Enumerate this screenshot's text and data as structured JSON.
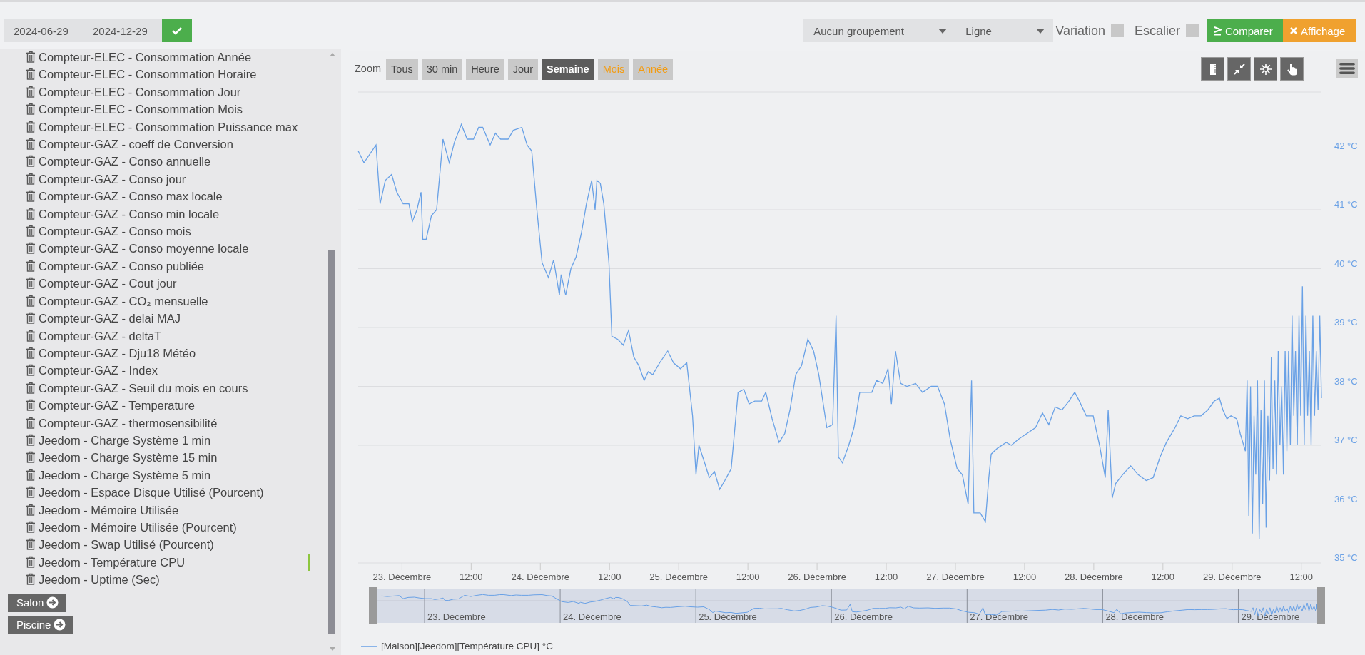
{
  "toolbar": {
    "start_date": "2024-06-29",
    "end_date": "2024-12-29",
    "grouping": "Aucun groupement",
    "chart_type": "Ligne",
    "options": [
      {
        "label": "Variation",
        "checked": false
      },
      {
        "label": "Escalier",
        "checked": false
      }
    ],
    "buttons": [
      {
        "kind": "compare",
        "label": "Comparer"
      },
      {
        "kind": "display",
        "label": "Affichage"
      }
    ]
  },
  "sidebar": {
    "items": [
      {
        "label": "Compteur-ELEC - Consommation Année",
        "selected": false
      },
      {
        "label": "Compteur-ELEC - Consommation Horaire",
        "selected": false
      },
      {
        "label": "Compteur-ELEC - Consommation Jour",
        "selected": false
      },
      {
        "label": "Compteur-ELEC - Consommation Mois",
        "selected": false
      },
      {
        "label": "Compteur-ELEC - Consommation Puissance max",
        "selected": false
      },
      {
        "label": "Compteur-GAZ - coeff de Conversion",
        "selected": false
      },
      {
        "label": "Compteur-GAZ - Conso annuelle",
        "selected": false
      },
      {
        "label": "Compteur-GAZ - Conso jour",
        "selected": false
      },
      {
        "label": "Compteur-GAZ - Conso max locale",
        "selected": false
      },
      {
        "label": "Compteur-GAZ - Conso min locale",
        "selected": false
      },
      {
        "label": "Compteur-GAZ - Conso mois",
        "selected": false
      },
      {
        "label": "Compteur-GAZ - Conso moyenne locale",
        "selected": false
      },
      {
        "label": "Compteur-GAZ - Conso publiée",
        "selected": false
      },
      {
        "label": "Compteur-GAZ - Cout jour",
        "selected": false
      },
      {
        "label": "Compteur-GAZ - CO₂ mensuelle",
        "selected": false
      },
      {
        "label": "Compteur-GAZ - delai MAJ",
        "selected": false
      },
      {
        "label": "Compteur-GAZ - deltaT",
        "selected": false
      },
      {
        "label": "Compteur-GAZ - Dju18 Météo",
        "selected": false
      },
      {
        "label": "Compteur-GAZ - Index",
        "selected": false
      },
      {
        "label": "Compteur-GAZ - Seuil du mois en cours",
        "selected": false
      },
      {
        "label": "Compteur-GAZ - Temperature",
        "selected": false
      },
      {
        "label": "Compteur-GAZ - thermosensibilité",
        "selected": false
      },
      {
        "label": "Jeedom - Charge Système 1 min",
        "selected": false
      },
      {
        "label": "Jeedom - Charge Système 15 min",
        "selected": false
      },
      {
        "label": "Jeedom - Charge Système 5 min",
        "selected": false
      },
      {
        "label": "Jeedom - Espace Disque Utilisé (Pourcent)",
        "selected": false
      },
      {
        "label": "Jeedom - Mémoire Utilisée",
        "selected": false
      },
      {
        "label": "Jeedom - Mémoire Utilisée (Pourcent)",
        "selected": false
      },
      {
        "label": "Jeedom - Swap Utilisé (Pourcent)",
        "selected": false
      },
      {
        "label": "Jeedom - Température CPU",
        "selected": true
      },
      {
        "label": "Jeedom - Uptime (Sec)",
        "selected": false
      }
    ],
    "rooms": [
      "Salon",
      "Piscine"
    ]
  },
  "chart_panel": {
    "zoom_label": "Zoom",
    "zoom_buttons": [
      {
        "label": "Tous",
        "selected": false,
        "disabled": false
      },
      {
        "label": "30 min",
        "selected": false,
        "disabled": false
      },
      {
        "label": "Heure",
        "selected": false,
        "disabled": false
      },
      {
        "label": "Jour",
        "selected": false,
        "disabled": false
      },
      {
        "label": "Semaine",
        "selected": true,
        "disabled": false
      },
      {
        "label": "Mois",
        "selected": false,
        "disabled": true
      },
      {
        "label": "Année",
        "selected": false,
        "disabled": true
      }
    ],
    "chart_data": {
      "type": "line",
      "grid": true,
      "x": [
        "2024-12-22 16:24",
        "2024-12-22 17:24",
        "2024-12-22 19:30",
        "2024-12-22 20:12",
        "2024-12-22 21:06",
        "2024-12-22 22:12",
        "2024-12-22 23:06",
        "2024-12-23 00:12",
        "2024-12-23 01:12",
        "2024-12-23 01:48",
        "2024-12-23 02:36",
        "2024-12-23 03:18",
        "2024-12-23 03:36",
        "2024-12-23 04:12",
        "2024-12-23 05:06",
        "2024-12-23 06:00",
        "2024-12-23 07:06",
        "2024-12-23 08:12",
        "2024-12-23 09:06",
        "2024-12-23 10:18",
        "2024-12-23 11:18",
        "2024-12-23 12:24",
        "2024-12-23 13:18",
        "2024-12-23 14:00",
        "2024-12-23 15:18",
        "2024-12-23 16:12",
        "2024-12-23 17:06",
        "2024-12-23 18:24",
        "2024-12-23 19:18",
        "2024-12-23 20:48",
        "2024-12-23 21:42",
        "2024-12-23 22:30",
        "2024-12-23 23:24",
        "2024-12-24 00:18",
        "2024-12-24 01:24",
        "2024-12-24 02:18",
        "2024-12-24 03:18",
        "2024-12-24 03:36",
        "2024-12-24 04:24",
        "2024-12-24 05:18",
        "2024-12-24 06:12",
        "2024-12-24 07:06",
        "2024-12-24 08:00",
        "2024-12-24 08:54",
        "2024-12-24 09:30",
        "2024-12-24 09:48",
        "2024-12-24 10:24",
        "2024-12-24 11:00",
        "2024-12-24 11:54",
        "2024-12-24 12:24",
        "2024-12-24 13:24",
        "2024-12-24 14:24",
        "2024-12-24 15:18",
        "2024-12-24 16:12",
        "2024-12-24 17:06",
        "2024-12-24 18:00",
        "2024-12-24 18:42",
        "2024-12-24 19:30",
        "2024-12-24 20:42",
        "2024-12-24 22:06",
        "2024-12-24 23:06",
        "2024-12-25 00:18",
        "2024-12-25 01:24",
        "2024-12-25 02:24",
        "2024-12-25 03:00",
        "2024-12-25 03:30",
        "2024-12-25 04:30",
        "2024-12-25 05:18",
        "2024-12-25 06:12",
        "2024-12-25 07:06",
        "2024-12-25 08:00",
        "2024-12-25 09:06",
        "2024-12-25 10:18",
        "2024-12-25 11:18",
        "2024-12-25 12:12",
        "2024-12-25 13:12",
        "2024-12-25 14:24",
        "2024-12-25 15:06",
        "2024-12-25 16:12",
        "2024-12-25 17:24",
        "2024-12-25 18:24",
        "2024-12-25 19:18",
        "2024-12-25 20:18",
        "2024-12-25 21:18",
        "2024-12-25 22:24",
        "2024-12-25 23:24",
        "2024-12-26 00:18",
        "2024-12-26 01:42",
        "2024-12-26 02:42",
        "2024-12-26 03:18",
        "2024-12-26 03:42",
        "2024-12-26 04:24",
        "2024-12-26 05:30",
        "2024-12-26 06:24",
        "2024-12-26 07:24",
        "2024-12-26 08:30",
        "2024-12-26 09:30",
        "2024-12-26 10:18",
        "2024-12-26 11:24",
        "2024-12-26 12:18",
        "2024-12-26 12:54",
        "2024-12-26 13:36",
        "2024-12-26 14:30",
        "2024-12-26 15:36",
        "2024-12-26 17:06",
        "2024-12-26 18:18",
        "2024-12-26 19:48",
        "2024-12-26 20:54",
        "2024-12-26 22:06",
        "2024-12-26 23:06",
        "2024-12-27 00:18",
        "2024-12-27 01:12",
        "2024-12-27 02:12",
        "2024-12-27 02:48",
        "2024-12-27 03:12",
        "2024-12-27 04:18",
        "2024-12-27 05:12",
        "2024-12-27 05:48",
        "2024-12-27 06:12",
        "2024-12-27 07:18",
        "2024-12-27 08:48",
        "2024-12-27 09:42",
        "2024-12-27 10:54",
        "2024-12-27 12:24",
        "2024-12-27 13:54",
        "2024-12-27 15:06",
        "2024-12-27 16:12",
        "2024-12-27 17:18",
        "2024-12-27 18:30",
        "2024-12-27 19:42",
        "2024-12-27 20:42",
        "2024-12-27 21:30",
        "2024-12-27 22:42",
        "2024-12-27 23:54",
        "2024-12-28 01:00",
        "2024-12-28 02:00",
        "2024-12-28 02:30",
        "2024-12-28 03:12",
        "2024-12-28 03:48",
        "2024-12-28 05:00",
        "2024-12-28 06:24",
        "2024-12-28 07:42",
        "2024-12-28 09:06",
        "2024-12-28 10:18",
        "2024-12-28 11:30",
        "2024-12-28 12:36",
        "2024-12-28 14:06",
        "2024-12-28 15:06",
        "2024-12-28 16:18",
        "2024-12-28 17:24",
        "2024-12-28 18:36",
        "2024-12-28 19:48",
        "2024-12-28 20:54",
        "2024-12-28 21:48",
        "2024-12-28 22:24",
        "2024-12-28 23:06",
        "2024-12-28 23:48",
        "2024-12-29 00:48",
        "2024-12-29 01:24",
        "2024-12-29 02:18",
        "2024-12-29 02:36",
        "2024-12-29 02:54",
        "2024-12-29 03:12",
        "2024-12-29 03:30",
        "2024-12-29 03:48",
        "2024-12-29 04:06",
        "2024-12-29 04:24",
        "2024-12-29 04:42",
        "2024-12-29 05:00",
        "2024-12-29 05:18",
        "2024-12-29 05:36",
        "2024-12-29 05:54",
        "2024-12-29 06:12",
        "2024-12-29 06:30",
        "2024-12-29 06:48",
        "2024-12-29 07:06",
        "2024-12-29 07:24",
        "2024-12-29 07:42",
        "2024-12-29 08:00",
        "2024-12-29 08:18",
        "2024-12-29 08:36",
        "2024-12-29 08:54",
        "2024-12-29 09:12",
        "2024-12-29 09:30",
        "2024-12-29 09:48",
        "2024-12-29 10:06",
        "2024-12-29 10:24",
        "2024-12-29 10:42",
        "2024-12-29 11:00",
        "2024-12-29 11:18",
        "2024-12-29 11:36",
        "2024-12-29 11:54",
        "2024-12-29 12:12",
        "2024-12-29 12:30",
        "2024-12-29 12:48",
        "2024-12-29 13:06",
        "2024-12-29 13:24",
        "2024-12-29 13:42",
        "2024-12-29 14:00",
        "2024-12-29 14:18",
        "2024-12-29 14:36",
        "2024-12-29 14:54",
        "2024-12-29 15:12",
        "2024-12-29 15:30"
      ],
      "series": [
        {
          "name": "[Maison][Jeedom][Température CPU] °C",
          "color": "#69a1e6",
          "values": [
            42.0,
            41.8,
            42.1,
            41.1,
            41.5,
            41.6,
            41.3,
            41.1,
            41.1,
            40.8,
            41.0,
            41.3,
            40.5,
            40.5,
            40.9,
            41.0,
            42.2,
            41.8,
            42.15,
            42.45,
            42.2,
            42.2,
            42.4,
            42.4,
            42.1,
            42.3,
            42.2,
            42.2,
            42.35,
            42.4,
            42.1,
            42.0,
            41.0,
            40.1,
            39.85,
            40.15,
            39.55,
            39.9,
            39.55,
            40.0,
            40.2,
            40.6,
            41.1,
            41.5,
            41.0,
            41.5,
            41.45,
            41.1,
            40.1,
            38.85,
            38.8,
            38.7,
            38.95,
            38.5,
            38.35,
            38.1,
            38.25,
            38.2,
            38.4,
            38.6,
            38.4,
            38.3,
            38.4,
            37.5,
            36.5,
            37.0,
            36.7,
            36.45,
            36.55,
            36.25,
            36.4,
            36.6,
            37.9,
            37.95,
            37.7,
            37.75,
            37.75,
            37.9,
            37.45,
            37.05,
            37.2,
            37.6,
            38.2,
            38.35,
            38.8,
            38.6,
            38.2,
            37.3,
            37.35,
            39.2,
            36.8,
            36.7,
            37.0,
            37.3,
            37.9,
            37.9,
            37.9,
            38.1,
            38.05,
            38.3,
            37.7,
            38.6,
            38.05,
            38.0,
            38.05,
            37.9,
            38.0,
            38.0,
            37.7,
            37.1,
            36.6,
            36.5,
            36.0,
            38.1,
            35.85,
            35.85,
            35.7,
            36.45,
            36.85,
            36.95,
            37.05,
            37.0,
            37.1,
            37.2,
            37.3,
            37.55,
            37.35,
            37.65,
            37.6,
            37.75,
            37.9,
            37.75,
            37.5,
            37.5,
            37.0,
            36.45,
            37.6,
            36.1,
            36.35,
            36.5,
            36.65,
            36.5,
            36.4,
            36.45,
            36.8,
            37.05,
            37.3,
            37.5,
            37.45,
            37.5,
            37.5,
            37.6,
            37.75,
            37.8,
            37.6,
            37.45,
            37.5,
            37.45,
            37.2,
            36.9,
            38.1,
            35.8,
            38.0,
            35.5,
            37.5,
            36.5,
            38.1,
            35.4,
            37.6,
            36.0,
            38.1,
            35.6,
            37.5,
            36.4,
            38.5,
            36.6,
            38.1,
            36.5,
            38.6,
            37.0,
            38.0,
            36.5,
            38.6,
            36.9,
            38.6,
            37.0,
            39.2,
            37.5,
            38.6,
            37.0,
            39.2,
            37.5,
            39.7,
            37.0,
            39.2,
            37.5,
            38.6,
            37.0,
            39.2,
            37.5,
            38.6,
            37.6,
            39.2,
            37.8
          ]
        }
      ],
      "xlim": [
        "2024-12-22 16:24",
        "2024-12-29 15:30"
      ],
      "ylim": [
        35,
        43
      ],
      "xticks": [
        {
          "value": "2024-12-23 00:00",
          "label": "23. Décembre"
        },
        {
          "value": "2024-12-23 12:00",
          "label": "12:00"
        },
        {
          "value": "2024-12-24 00:00",
          "label": "24. Décembre"
        },
        {
          "value": "2024-12-24 12:00",
          "label": "12:00"
        },
        {
          "value": "2024-12-25 00:00",
          "label": "25. Décembre"
        },
        {
          "value": "2024-12-25 12:00",
          "label": "12:00"
        },
        {
          "value": "2024-12-26 00:00",
          "label": "26. Décembre"
        },
        {
          "value": "2024-12-26 12:00",
          "label": "12:00"
        },
        {
          "value": "2024-12-27 00:00",
          "label": "27. Décembre"
        },
        {
          "value": "2024-12-27 12:00",
          "label": "12:00"
        },
        {
          "value": "2024-12-28 00:00",
          "label": "28. Décembre"
        },
        {
          "value": "2024-12-28 12:00",
          "label": "12:00"
        },
        {
          "value": "2024-12-29 00:00",
          "label": "29. Décembre"
        },
        {
          "value": "2024-12-29 12:00",
          "label": "12:00"
        }
      ],
      "yticks": [
        {
          "value": 35,
          "label": "35 °C"
        },
        {
          "value": 36,
          "label": "36 °C"
        },
        {
          "value": 37,
          "label": "37 °C"
        },
        {
          "value": 38,
          "label": "38 °C"
        },
        {
          "value": 39,
          "label": "39 °C"
        },
        {
          "value": 40,
          "label": "40 °C"
        },
        {
          "value": 41,
          "label": "41 °C"
        },
        {
          "value": 42,
          "label": "42 °C"
        }
      ]
    },
    "navigator_labels": [
      "23. Décembre",
      "24. Décembre",
      "25. Décembre",
      "26. Décembre",
      "27. Décembre",
      "28. Décembre",
      "29. Décembre"
    ]
  }
}
